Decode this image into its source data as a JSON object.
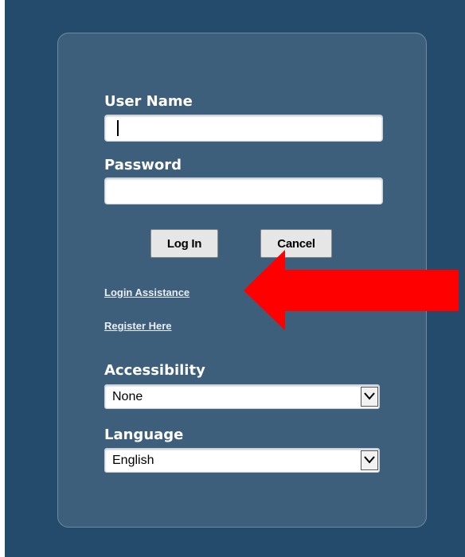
{
  "login_form": {
    "username_label": "User Name",
    "username_value": "",
    "password_label": "Password",
    "password_value": "",
    "login_button_label": "Log In",
    "cancel_button_label": "Cancel"
  },
  "links": {
    "login_assistance": "Login Assistance",
    "register_here": "Register Here"
  },
  "accessibility": {
    "label": "Accessibility",
    "selected": "None"
  },
  "language": {
    "label": "Language",
    "selected": "English"
  },
  "annotation": {
    "icon": "red-pointer-arrow",
    "color": "#ff0000"
  },
  "colors": {
    "page_background": "#244b6b",
    "panel_background": "#3d5f7c"
  }
}
